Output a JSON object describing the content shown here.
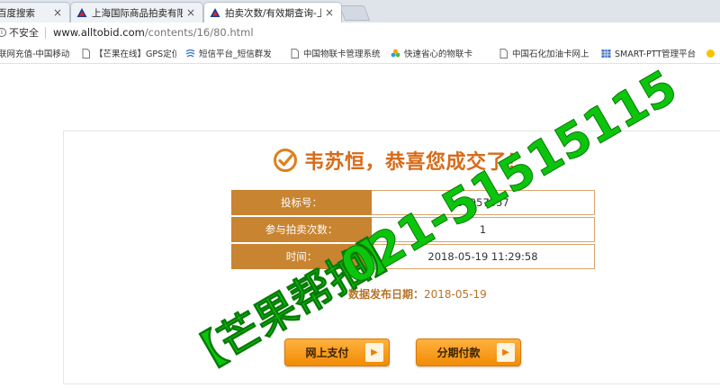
{
  "browser": {
    "tabs": [
      {
        "title": "百度搜索",
        "icon": "page-icon"
      },
      {
        "title": "上海国际商品拍卖有限公",
        "icon": "triangle-logo-icon"
      },
      {
        "title": "拍卖次数/有效期查询-上",
        "icon": "triangle-logo-icon"
      }
    ],
    "close_glyph": "×",
    "address": {
      "security_label": "不安全",
      "url_host": "www.alltobid.com",
      "url_path": "/contents/16/80.html"
    },
    "bookmarks": [
      {
        "label": "联网充值-中国移动",
        "icon": "none"
      },
      {
        "label": "【芒果在线】GPS定位",
        "icon": "page-icon"
      },
      {
        "label": "短信平台_短信群发",
        "icon": "sms-logo-icon"
      },
      {
        "label": "中国物联卡管理系统",
        "icon": "page-icon"
      },
      {
        "label": "快速省心的物联卡",
        "icon": "pinwheel-icon"
      },
      {
        "label": "中国石化加油卡网上",
        "icon": "page-icon"
      },
      {
        "label": "SMART-PTT管理平台",
        "icon": "grid-logo-icon"
      }
    ]
  },
  "result": {
    "headline": "韦苏恒，恭喜您成交了！",
    "rows": [
      {
        "label": "投标号：",
        "value": "54957057"
      },
      {
        "label": "参与拍卖次数：",
        "value": "1"
      },
      {
        "label": "时间：",
        "value": "2018-05-19 11:29:58"
      }
    ],
    "publish_label": "数据发布日期：",
    "publish_date": "2018-05-19",
    "buttons": {
      "online_pay": "网上支付",
      "installment_pay": "分期付款"
    },
    "arrow_glyph": "▶"
  },
  "watermark": {
    "brand": "【芒果帮拍】",
    "phone": "021-51515115"
  },
  "colors": {
    "label_bg": "#c88431",
    "headline": "#d76b1a",
    "button_orange": "#f18b05",
    "watermark_green": "#0cc40c"
  }
}
